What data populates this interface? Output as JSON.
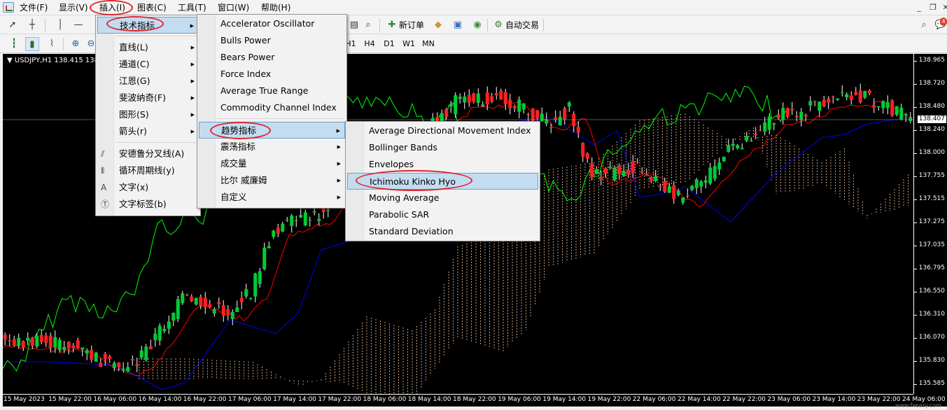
{
  "menubar": {
    "items": [
      "文件(F)",
      "显示(V)",
      "插入(I)",
      "图表(C)",
      "工具(T)",
      "窗口(W)",
      "帮助(H)"
    ]
  },
  "toolbar": {
    "new_order_label": "新订单",
    "auto_trade_label": "自动交易"
  },
  "timeframes": [
    "H1",
    "H4",
    "D1",
    "W1",
    "MN"
  ],
  "chart": {
    "symbol_label": "USDJPY,H1  138.415 138.4",
    "current_price": "138.407",
    "price_ticks": [
      "138.965",
      "138.720",
      "138.480",
      "138.240",
      "138.000",
      "137.755",
      "137.515",
      "137.275",
      "137.035",
      "136.795",
      "136.550",
      "136.310",
      "136.070",
      "135.830",
      "135.585"
    ],
    "time_ticks": [
      "15 May 2023",
      "15 May 22:00",
      "16 May 06:00",
      "16 May 14:00",
      "16 May 22:00",
      "17 May 06:00",
      "17 May 14:00",
      "17 May 22:00",
      "18 May 06:00",
      "18 May 14:00",
      "18 May 22:00",
      "19 May 06:00",
      "19 May 14:00",
      "19 May 22:00",
      "22 May 06:00",
      "22 May 14:00",
      "22 May 22:00",
      "23 May 06:00",
      "23 May 14:00",
      "23 May 22:00",
      "24 May 06:00"
    ],
    "colors": {
      "background": "#000000",
      "bull": "#00cc33",
      "bear": "#ff2020",
      "tenkan": "#ff0000",
      "kijun": "#0000ff",
      "chikou": "#00ff00",
      "cloud": "#f5c89a"
    }
  },
  "insert_menu": {
    "items": [
      {
        "label": "技术指标",
        "icon": "",
        "submenu": true,
        "selected": true
      },
      {
        "label": "直线(L)",
        "icon": "",
        "submenu": true
      },
      {
        "label": "通道(C)",
        "icon": "",
        "submenu": true
      },
      {
        "label": "江恩(G)",
        "icon": "",
        "submenu": true
      },
      {
        "label": "斐波纳奇(F)",
        "icon": "",
        "submenu": true
      },
      {
        "label": "图形(S)",
        "icon": "",
        "submenu": true
      },
      {
        "label": "箭头(r)",
        "icon": "",
        "submenu": true
      },
      {
        "label": "安德鲁分叉线(A)",
        "icon": "andrews-pitchfork-icon",
        "submenu": false
      },
      {
        "label": "循环周期线(y)",
        "icon": "cycle-lines-icon",
        "submenu": false
      },
      {
        "label": "文字(x)",
        "icon": "text-icon",
        "submenu": false
      },
      {
        "label": "文字标签(b)",
        "icon": "text-label-icon",
        "submenu": false
      }
    ]
  },
  "indicators_menu": {
    "items": [
      {
        "label": "Accelerator Oscillator",
        "submenu": false
      },
      {
        "label": "Bulls Power",
        "submenu": false
      },
      {
        "label": "Bears Power",
        "submenu": false
      },
      {
        "label": "Force Index",
        "submenu": false
      },
      {
        "label": "Average True Range",
        "submenu": false
      },
      {
        "label": "Commodity Channel Index",
        "submenu": false
      },
      {
        "label": "趋势指标",
        "submenu": true,
        "selected": true
      },
      {
        "label": "震荡指标",
        "submenu": true
      },
      {
        "label": "成交量",
        "submenu": true
      },
      {
        "label": "比尔 威廉姆",
        "submenu": true
      },
      {
        "label": "自定义",
        "submenu": true
      }
    ]
  },
  "trend_menu": {
    "items": [
      {
        "label": "Average Directional Movement Index"
      },
      {
        "label": "Bollinger Bands"
      },
      {
        "label": "Envelopes"
      },
      {
        "label": "Ichimoku Kinko Hyo",
        "selected": true
      },
      {
        "label": "Moving Average"
      },
      {
        "label": "Parabolic SAR"
      },
      {
        "label": "Standard Deviation"
      }
    ]
  },
  "watermark": "www.fxeasy.com"
}
